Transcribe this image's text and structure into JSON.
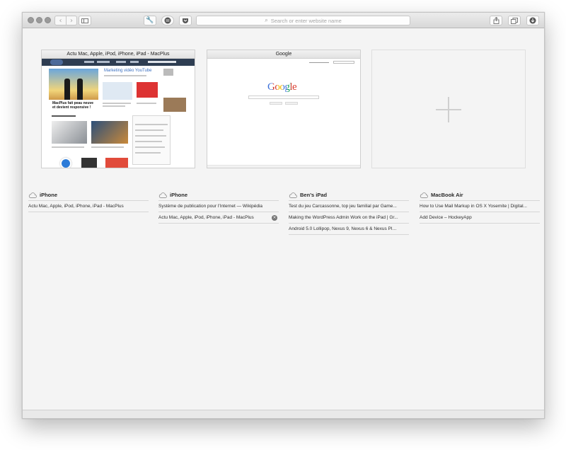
{
  "toolbar": {
    "search_placeholder": "Search or enter website name"
  },
  "top_sites": [
    {
      "title": "Actu Mac, Apple, iPod, iPhone, iPad - MacPlus"
    },
    {
      "title": "Google"
    }
  ],
  "macplus_page": {
    "promo_heading": "Marketing vidéo YouTube",
    "headline": "MacPlus fait peau neuve et devient responsive !"
  },
  "google_page": {
    "logo_text": "Google"
  },
  "devices": [
    {
      "name": "iPhone",
      "tabs": [
        "Actu Mac, Apple, iPod, iPhone, iPad - MacPlus"
      ]
    },
    {
      "name": "iPhone",
      "tabs": [
        "Système de publication pour l’Internet — Wikipédia",
        "Actu Mac, Apple, iPod, iPhone, iPad - MacPlus"
      ]
    },
    {
      "name": "Ben’s iPad",
      "tabs": [
        "Test du jeu Carcassonne, top jeu familial par Game...",
        "Making the WordPress Admin Work on the iPad | Gr...",
        "Android 5.0 Lollipop, Nexus 9, Nexus 6 & Nexus Player"
      ]
    },
    {
      "name": "MacBook Air",
      "tabs": [
        "How to Use Mail Markup in OS X Yosemite | Digital...",
        "Add Device – HockeyApp"
      ]
    }
  ],
  "icons": {
    "back": "chevron-left-icon",
    "forward": "chevron-right-icon",
    "sidebar": "sidebar-icon",
    "tools": "wrench-icon",
    "reader": "reader-icon",
    "pocket": "pocket-icon",
    "share": "share-icon",
    "tabs": "tabs-overview-icon",
    "downloads": "downloads-icon",
    "cloud": "cloud-icon",
    "close": "close-icon",
    "plus": "plus-icon"
  }
}
